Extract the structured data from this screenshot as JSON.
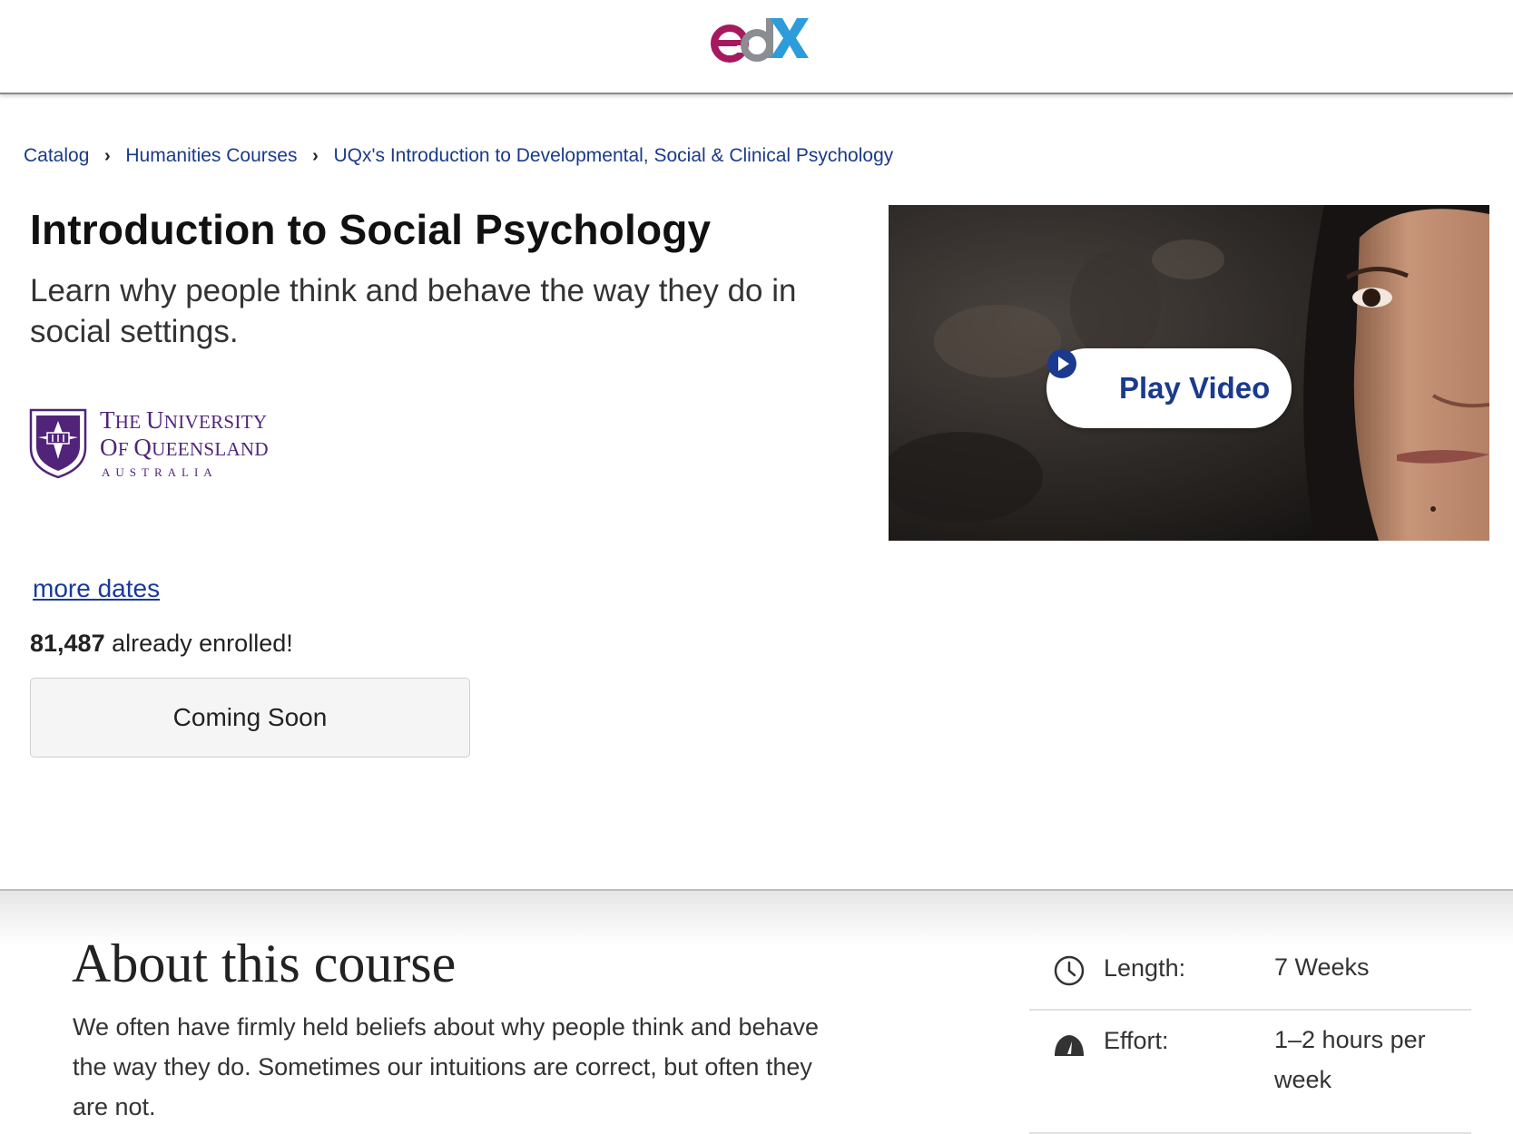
{
  "header": {
    "logo_text": "edX",
    "logo_colors": {
      "e": "#a6195e",
      "d": "#8a8d91",
      "x": "#2d9cdb"
    }
  },
  "breadcrumb": {
    "items": [
      "Catalog",
      "Humanities Courses",
      "UQx's Introduction to Developmental, Social & Clinical Psychology"
    ],
    "separator": "›"
  },
  "course": {
    "title": "Introduction to Social Psychology",
    "subtitle": "Learn why people think and behave the way they do in social settings.",
    "institution": {
      "line1": "The University",
      "line2": "of Queensland",
      "line3": "AUSTRALIA",
      "color": "#51247a"
    },
    "more_dates": "more dates",
    "enrolled_count": "81,487",
    "enrolled_text": " already enrolled!",
    "enroll_button": "Coming Soon",
    "video": {
      "play_label": "Play Video"
    }
  },
  "about": {
    "title": "About this course",
    "body": "We often have firmly held beliefs about why people think and behave the way they do. Sometimes our intuitions are correct, but often they are not."
  },
  "facts": [
    {
      "icon": "clock-icon",
      "label": "Length:",
      "value": "7 Weeks"
    },
    {
      "icon": "speedometer-icon",
      "label": "Effort:",
      "value": "1–2 hours per week"
    }
  ]
}
